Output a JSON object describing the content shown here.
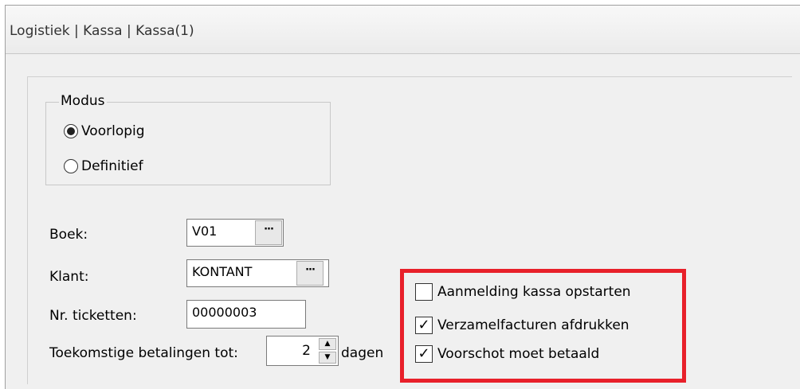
{
  "window": {
    "title": "Logistiek | Kassa | Kassa(1)"
  },
  "modus": {
    "legend": "Modus",
    "options": [
      {
        "label": "Voorlopig",
        "checked": true
      },
      {
        "label": "Definitief",
        "checked": false
      }
    ]
  },
  "form": {
    "boek": {
      "label": "Boek:",
      "value": "V01",
      "button": "···"
    },
    "klant": {
      "label": "Klant:",
      "value": "KONTANT",
      "button": "···"
    },
    "tickets": {
      "label": "Nr. ticketten:",
      "value": "00000003"
    },
    "future": {
      "label": "Toekomstige betalingen tot:",
      "value": "2",
      "suffix": "dagen",
      "up": "▲",
      "down": "▼"
    }
  },
  "options": [
    {
      "label": "Aanmelding kassa opstarten",
      "checked": false
    },
    {
      "label": "Verzamelfacturen afdrukken",
      "checked": true
    },
    {
      "label": "Voorschot moet betaald",
      "checked": true
    }
  ],
  "colors": {
    "highlight": "#e8202a"
  }
}
